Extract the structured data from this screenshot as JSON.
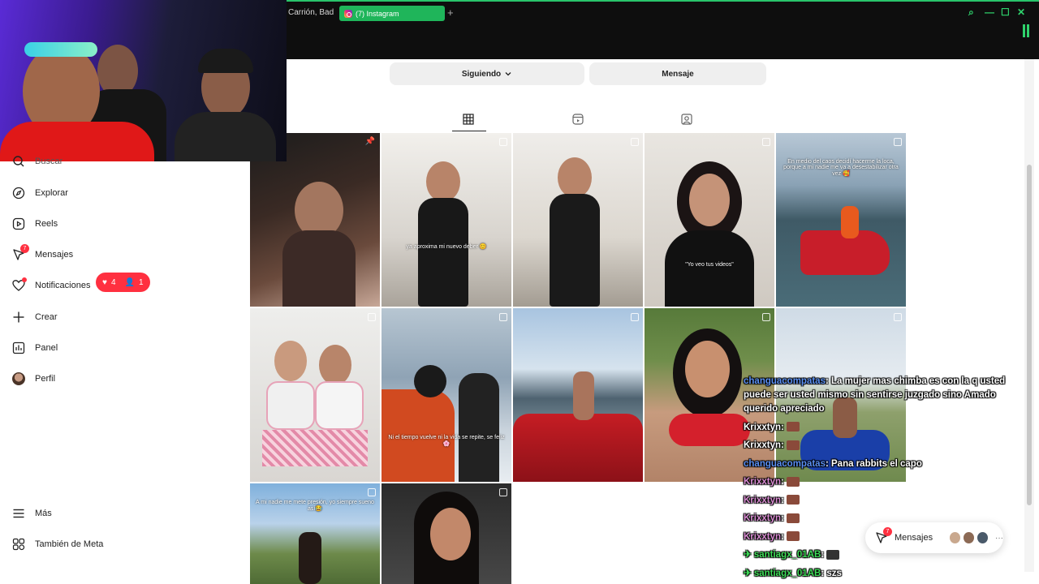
{
  "browser": {
    "prev_tab": "Carrión, Bad",
    "active_tab": "(7) Instagram",
    "add_tab": "+",
    "controls": {
      "search": "⌕",
      "minimize": "—",
      "maximize": "☐",
      "close": "✕"
    }
  },
  "sidebar": {
    "items": [
      {
        "label": "Buscar",
        "icon": "search-icon"
      },
      {
        "label": "Explorar",
        "icon": "compass-icon"
      },
      {
        "label": "Reels",
        "icon": "reels-icon"
      },
      {
        "label": "Mensajes",
        "icon": "messenger-icon",
        "badge": "7"
      },
      {
        "label": "Notificaciones",
        "icon": "heart-icon"
      },
      {
        "label": "Crear",
        "icon": "plus-icon"
      },
      {
        "label": "Panel",
        "icon": "chart-icon"
      },
      {
        "label": "Perfil",
        "icon": "avatar"
      },
      {
        "label": "Más",
        "icon": "menu-icon"
      },
      {
        "label": "También de Meta",
        "icon": "meta-icon"
      }
    ],
    "notification_pill": {
      "likes": "4",
      "followers": "1"
    }
  },
  "profile": {
    "following_button": "Siguiendo",
    "message_button": "Mensaje"
  },
  "tabs": [
    "posts-grid-icon",
    "reels-tab-icon",
    "tagged-tab-icon"
  ],
  "posts": [
    {
      "caption": "",
      "pinned": true
    },
    {
      "caption": "ya aproxima mi nuevo deber 😊"
    },
    {
      "caption": ""
    },
    {
      "caption": "\"Yo veo tus videos\""
    },
    {
      "caption": "En medio del caos decidí hacerme la loca, porque a mi nadie me va a desestabilizar otra vez 🥰"
    },
    {
      "caption": ""
    },
    {
      "caption": "Ni el tiempo vuelve ni la vida se repite, se feliz 🌸"
    },
    {
      "caption": ""
    },
    {
      "caption": ""
    },
    {
      "caption": ""
    },
    {
      "caption": "A mi nadie me mete presión, yo siempre sueno así😂"
    },
    {
      "caption": ""
    }
  ],
  "chat": [
    {
      "user": "changuacompatas",
      "color": "blue",
      "text": "La mujer mas chimba es con la q usted puede ser usted mismo sin sentirse juzgado sino Amado querido apreciado"
    },
    {
      "user": "Krixxtyn",
      "color": "white",
      "text": "",
      "emote": true
    },
    {
      "user": "Krixxtyn",
      "color": "white",
      "text": "",
      "emote": true
    },
    {
      "user": "changuacompatas",
      "color": "blue",
      "text": "Pana rabbits el capo"
    },
    {
      "user": "Krixxtyn",
      "color": "pink",
      "text": "",
      "emote": true
    },
    {
      "user": "Krixxtyn",
      "color": "pink",
      "text": "",
      "emote": true
    },
    {
      "user": "Krixxtyn",
      "color": "pink",
      "text": "",
      "emote": true
    },
    {
      "user": "Krixxtyn",
      "color": "pink",
      "text": "",
      "emote": true
    },
    {
      "user": "santiagx_01AB",
      "color": "green",
      "text": "",
      "emote": true
    },
    {
      "user": "santiagx_01AB",
      "color": "green",
      "text": "szs"
    }
  ],
  "messages_button": {
    "label": "Mensajes",
    "badge": "7",
    "more": "···"
  }
}
